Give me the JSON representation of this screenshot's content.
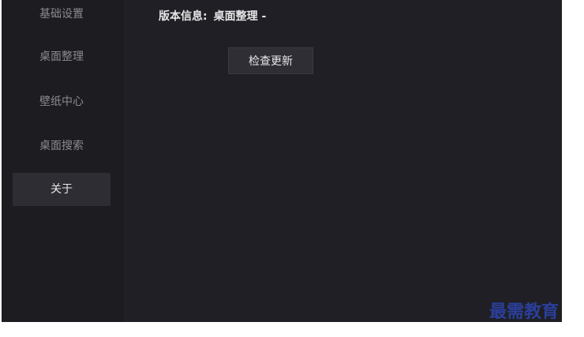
{
  "sidebar": {
    "items": [
      {
        "label": "基础设置"
      },
      {
        "label": "桌面整理"
      },
      {
        "label": "壁纸中心"
      },
      {
        "label": "桌面搜索"
      },
      {
        "label": "关于"
      }
    ],
    "active_index": 4
  },
  "about": {
    "version_label": "版本信息:",
    "version_value": "桌面整理 -",
    "check_update_label": "检查更新"
  },
  "watermark": {
    "text": "最需教育"
  },
  "colors": {
    "background": "#1f1f25",
    "sidebar": "#1c1c21",
    "active_item": "#2d2d33",
    "watermark": "#2b3f9a"
  }
}
